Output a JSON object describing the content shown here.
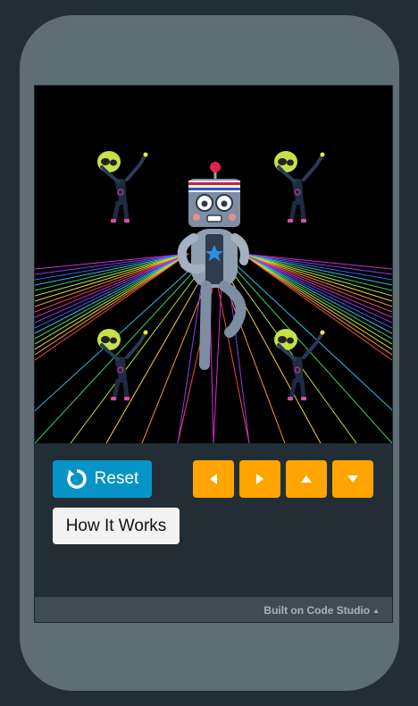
{
  "game": {
    "characters": {
      "main": "robot-dancer",
      "backup": [
        "alien-dancer",
        "alien-dancer",
        "alien-dancer",
        "alien-dancer"
      ]
    },
    "background": "rainbow-laser-floor"
  },
  "controls": {
    "reset_label": "Reset",
    "how_it_works_label": "How It Works",
    "arrows": [
      "left",
      "right",
      "up",
      "down"
    ]
  },
  "footer": {
    "built_on_label": "Built on Code Studio"
  },
  "colors": {
    "frame": "#5f6e75",
    "page_bg": "#232d35",
    "reset_button": "#0694c7",
    "arrow_button": "#ffa400",
    "how_button": "#f2f2f2"
  }
}
